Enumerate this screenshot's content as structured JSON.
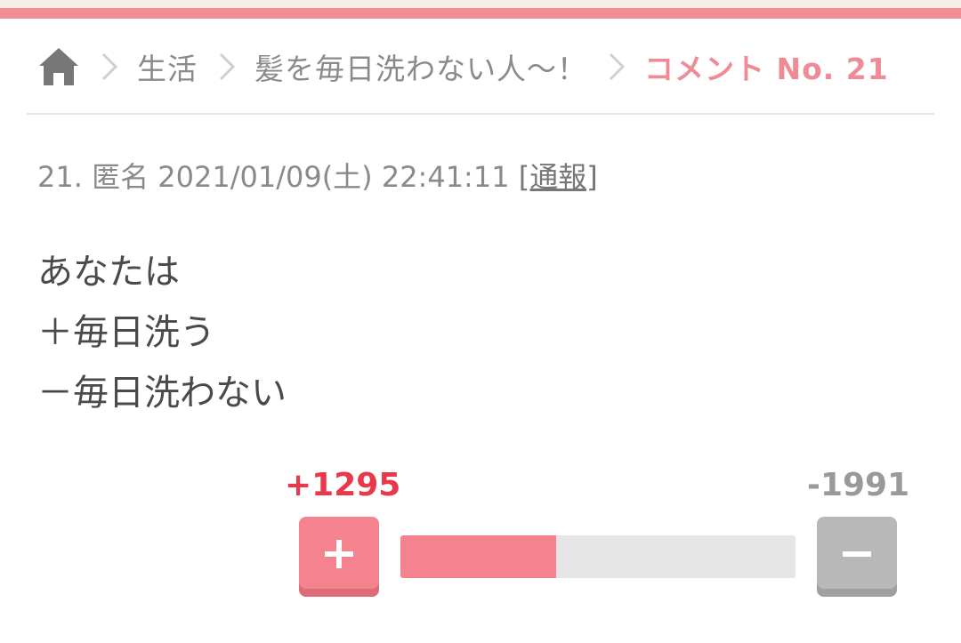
{
  "breadcrumb": {
    "items": [
      "生活",
      "髪を毎日洗わない人〜！"
    ],
    "current": "コメント No. 21"
  },
  "comment": {
    "number": "21.",
    "author": "匿名",
    "datetime": "2021/01/09(土) 22:41:11",
    "report_label": "[通報]",
    "body_lines": [
      "あなたは",
      "＋毎日洗う",
      "－毎日洗わない"
    ]
  },
  "votes": {
    "plus_label": "+1295",
    "minus_label": "-1991",
    "plus": 1295,
    "minus": 1991
  },
  "icons": {
    "home": "home-icon",
    "separator": "chevron-right-icon",
    "plus": "plus-icon",
    "minus": "minus-icon"
  },
  "colors": {
    "accent": "#f28d96",
    "plus_text": "#e8394a",
    "bar_fill": "#f5838f",
    "bar_bg": "#e5e5e5"
  }
}
